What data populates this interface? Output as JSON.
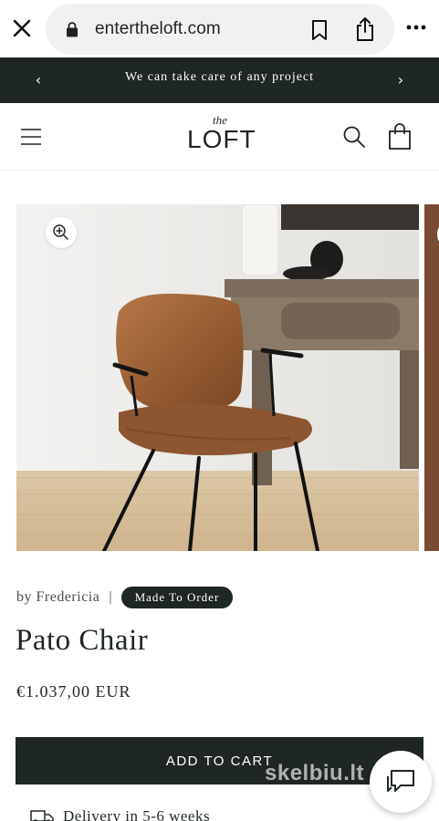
{
  "browser": {
    "url": "entertheloft.com",
    "icons": [
      "close-icon",
      "lock-icon",
      "bookmark-icon",
      "share-icon",
      "more-icon"
    ]
  },
  "announcement": {
    "text": "We can take care of any project",
    "prev_label": "‹",
    "next_label": "›"
  },
  "header": {
    "logo_small": "the",
    "logo_main": "LOFT",
    "icons": [
      "hamburger-menu-icon",
      "search-icon",
      "cart-icon"
    ]
  },
  "product": {
    "vendor": "by Fredericia",
    "divider": "|",
    "badge": "Made To Order",
    "title": "Pato Chair",
    "price": "€1.037,00 EUR",
    "add_to_cart": "ADD TO CART",
    "delivery": "Delivery in 5-6 weeks"
  },
  "overlay": {
    "watermark": "skelbiu.lt"
  },
  "colors": {
    "brand_dark": "#1f2723",
    "chair_leather": "#9a5e38",
    "background": "#ffffff"
  }
}
